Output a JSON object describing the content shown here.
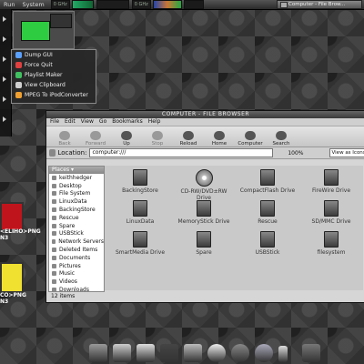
{
  "top_panel": {
    "menus": [
      "Run",
      "System"
    ],
    "slots": [
      "0 GHz",
      "",
      "",
      "0 GHz"
    ],
    "task_button": "Computer - File Brow..."
  },
  "left_menu": {
    "items": [
      {
        "label": "Dump GUI",
        "color": "#5aa0ff"
      },
      {
        "label": "Force Quit",
        "color": "#e04040"
      },
      {
        "label": "Playlist Maker",
        "color": "#40c060"
      },
      {
        "label": "View Clipboard",
        "color": "#d0d0d0"
      },
      {
        "label": "MPEG To iPodConverter",
        "color": "#f0a030"
      }
    ]
  },
  "widgets": {
    "red": {
      "label1": "<ELIHO>PNG",
      "label2": "N3"
    },
    "yellow": {
      "label1": "CO>PNG",
      "label2": "N3"
    }
  },
  "window": {
    "title": "COMPUTER - FILE BROWSER",
    "menubar": [
      "File",
      "Edit",
      "View",
      "Go",
      "Bookmarks",
      "Help"
    ],
    "toolbar": [
      {
        "label": "Back",
        "active": false
      },
      {
        "label": "Forward",
        "active": false
      },
      {
        "label": "Up",
        "active": true
      },
      {
        "label": "Stop",
        "active": false
      },
      {
        "label": "Reload",
        "active": true
      },
      {
        "label": "Home",
        "active": true
      },
      {
        "label": "Computer",
        "active": true
      },
      {
        "label": "Search",
        "active": true
      }
    ],
    "location": {
      "label": "Location:",
      "value": "computer:///"
    },
    "zoom": "100%",
    "view_as": "View as Icons",
    "sidebar": {
      "header": "Places ▾",
      "items": [
        "keithhedger",
        "Desktop",
        "File System",
        "LinuxData",
        "BackingStore",
        "Rescue",
        "Spare",
        "USBStick",
        "Network Servers",
        "Deleted Items",
        "Documents",
        "Pictures",
        "Music",
        "Videos",
        "Downloads"
      ]
    },
    "icons": [
      {
        "label": "BackingStore",
        "type": "drive"
      },
      {
        "label": "CD-RW/DVD±RW Drive",
        "type": "cd"
      },
      {
        "label": "CompactFlash Drive",
        "type": "drive"
      },
      {
        "label": "FireWire Drive",
        "type": "drive"
      },
      {
        "label": "LinuxData",
        "type": "drive"
      },
      {
        "label": "MemoryStick Drive",
        "type": "drive"
      },
      {
        "label": "Rescue",
        "type": "drive"
      },
      {
        "label": "SD/MMC Drive",
        "type": "drive"
      },
      {
        "label": "SmartMedia Drive",
        "type": "drive"
      },
      {
        "label": "Spare",
        "type": "drive"
      },
      {
        "label": "USBStick",
        "type": "usb"
      },
      {
        "label": "filesystem",
        "type": "drive"
      }
    ],
    "status": "12 items"
  },
  "dock": [
    "drive-icon",
    "apps-icon",
    "mail-icon",
    "monitor-icon",
    "shell-icon",
    "eye-icon",
    "camera-icon",
    "globe-icon",
    "ipod-icon",
    "phone-icon"
  ]
}
